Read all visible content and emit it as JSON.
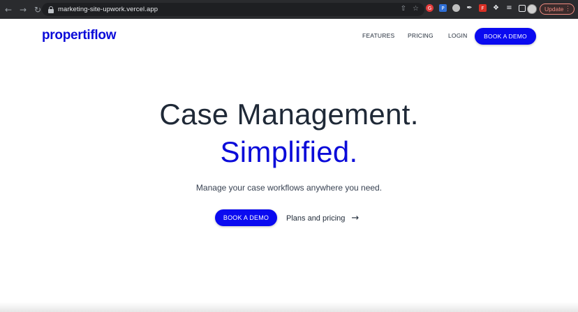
{
  "browser": {
    "url": "marketing-site-upwork.vercel.app",
    "back_icon": "arrow-left-icon",
    "forward_icon": "arrow-right-icon",
    "reload_icon": "reload-icon",
    "update_label": "Update"
  },
  "header": {
    "logo": "propertiflow",
    "nav": [
      {
        "label": "FEATURES"
      },
      {
        "label": "PRICING"
      },
      {
        "label": "LOGIN"
      }
    ],
    "cta_label": "BOOK A DEMO"
  },
  "hero": {
    "title_line1": "Case Management.",
    "title_line2": "Simplified.",
    "subtitle": "Manage your case workflows anywhere you need.",
    "primary_cta": "BOOK A DEMO",
    "secondary_cta": "Plans and pricing"
  },
  "colors": {
    "brand": "#0b0bd9",
    "button": "#0a0af0",
    "heading": "#1f2937"
  }
}
